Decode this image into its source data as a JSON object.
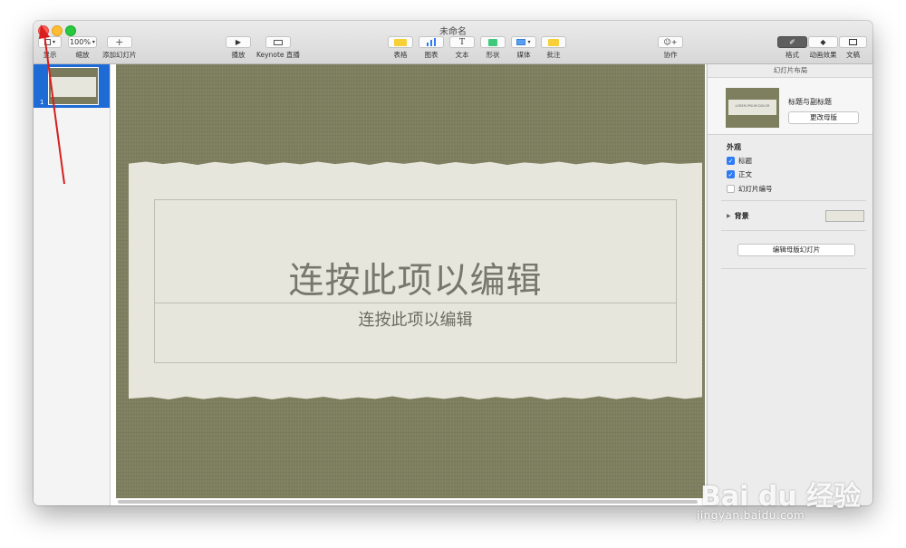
{
  "window": {
    "title": "未命名"
  },
  "toolbar": {
    "view": {
      "label": "显示"
    },
    "zoom": {
      "value": "100%",
      "label": "缩放"
    },
    "add_slide": {
      "label": "添加幻灯片"
    },
    "play": {
      "label": "播放"
    },
    "keynote_live": {
      "label": "Keynote 直播"
    },
    "table": {
      "label": "表格"
    },
    "chart": {
      "label": "图表"
    },
    "text": {
      "label": "文本"
    },
    "shape": {
      "label": "形状"
    },
    "media": {
      "label": "媒体"
    },
    "comment": {
      "label": "批注"
    },
    "collaborate": {
      "label": "协作"
    },
    "format": {
      "label": "格式"
    },
    "animate": {
      "label": "动画效果"
    },
    "document": {
      "label": "文稿"
    }
  },
  "navigator": {
    "slides": [
      {
        "number": "1",
        "selected": true
      }
    ]
  },
  "slide": {
    "title_placeholder": "连按此项以编辑",
    "subtitle_placeholder": "连按此项以编辑",
    "background_color": "#7e7f5f",
    "paper_color": "#e6e6dc"
  },
  "inspector": {
    "header": "幻灯片布局",
    "layout_name": "标题与副标题",
    "change_master_label": "更改母版",
    "thumb_text": "LOREM IPSUM DOLOR",
    "appearance_title": "外观",
    "options": [
      {
        "label": "标题",
        "checked": true
      },
      {
        "label": "正文",
        "checked": true
      },
      {
        "label": "幻灯片编号",
        "checked": false
      }
    ],
    "background_label": "背景",
    "edit_master_label": "编辑母版幻灯片"
  },
  "watermark": {
    "logo": "Bai du 经验",
    "url": "jingyan.baidu.com"
  },
  "colors": {
    "accent": "#1f6bd6",
    "annotation_arrow": "#d81e1e"
  }
}
